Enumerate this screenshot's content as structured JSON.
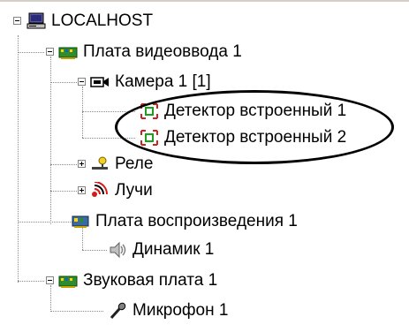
{
  "tree": {
    "localhost": {
      "label": "LOCALHOST",
      "icon": "computer-icon"
    },
    "video_board": {
      "label": "Плата видеоввода 1",
      "icon": "video-board-icon"
    },
    "camera": {
      "label": "Камера 1 [1]",
      "icon": "camera-icon"
    },
    "detector1": {
      "label": "Детектор встроенный 1",
      "icon": "detector-icon"
    },
    "detector2": {
      "label": "Детектор встроенный 2",
      "icon": "detector-icon"
    },
    "relay": {
      "label": "Реле",
      "icon": "relay-icon"
    },
    "rays": {
      "label": "Лучи",
      "icon": "rays-icon"
    },
    "playback_board": {
      "label": "Плата воспроизведения 1",
      "icon": "playback-board-icon"
    },
    "speaker": {
      "label": "Динамик 1",
      "icon": "speaker-icon"
    },
    "sound_board": {
      "label": "Звуковая плата 1",
      "icon": "sound-board-icon"
    },
    "microphone": {
      "label": "Микрофон 1",
      "icon": "microphone-icon"
    }
  },
  "colors": {
    "board_green": "#2e8b2e",
    "highlight_ellipse": "#000000",
    "tree_lines": "#8a8a8a"
  }
}
